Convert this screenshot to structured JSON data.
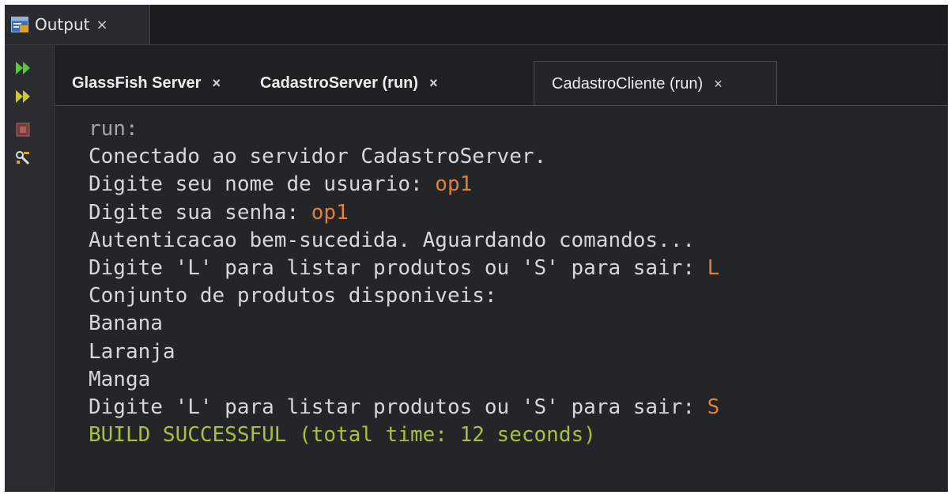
{
  "window_tab": {
    "title": "Output",
    "close": "×"
  },
  "colors": {
    "background": "#242528",
    "text": "#d7d7d7",
    "input": "#e0803a",
    "success": "#a7c13a"
  },
  "sub_tabs": [
    {
      "label": "GlassFish Server",
      "close": "×"
    },
    {
      "label": "CadastroServer (run)",
      "close": "×"
    },
    {
      "label": "CadastroCliente (run)",
      "close": "×"
    }
  ],
  "toolbar": [
    {
      "icon": "rerun-icon"
    },
    {
      "icon": "rerun-with-arguments-icon"
    },
    {
      "icon": "stop-icon"
    },
    {
      "icon": "settings-icon"
    }
  ],
  "console": {
    "lines": [
      {
        "text": "run:",
        "input": ""
      },
      {
        "text": "Conectado ao servidor CadastroServer.",
        "input": ""
      },
      {
        "text": "Digite seu nome de usuario: ",
        "input": "op1"
      },
      {
        "text": "Digite sua senha: ",
        "input": "op1"
      },
      {
        "text": "Autenticacao bem-sucedida. Aguardando comandos...",
        "input": ""
      },
      {
        "text": "Digite 'L' para listar produtos ou 'S' para sair: ",
        "input": "L"
      },
      {
        "text": "Conjunto de produtos disponiveis:",
        "input": ""
      },
      {
        "text": "Banana",
        "input": ""
      },
      {
        "text": "Laranja",
        "input": ""
      },
      {
        "text": "Manga",
        "input": ""
      },
      {
        "text": "Digite 'L' para listar produtos ou 'S' para sair: ",
        "input": "S"
      },
      {
        "text": "BUILD SUCCESSFUL (total time: 12 seconds)",
        "input": ""
      }
    ]
  }
}
